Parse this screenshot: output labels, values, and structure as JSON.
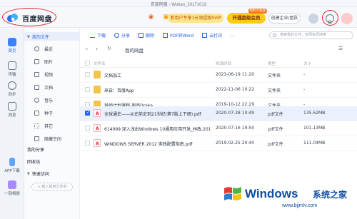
{
  "window_title": "百度网盘 - Wuhan_20171013",
  "header": {
    "app_name": "百度网盘",
    "promo_text": "新用户专享1元领超级SVIP",
    "open_svip": "开通超级会员",
    "open_svip_tag": "福利大放送",
    "enterprise": "创建企业/团队"
  },
  "rail": [
    {
      "label": "首页",
      "icon": "home-icon"
    },
    {
      "label": "传输",
      "icon": "transfer-icon"
    },
    {
      "label": "同步",
      "icon": "sync-icon"
    },
    {
      "label": "消息",
      "icon": "message-icon"
    },
    {
      "label": "APP下载",
      "icon": "phone-icon"
    },
    {
      "label": "一刻相册",
      "icon": "album-icon"
    }
  ],
  "sidebar": {
    "my_files": "我的文件",
    "items": [
      {
        "label": "最近",
        "icon": "clock-icon"
      },
      {
        "label": "图片",
        "icon": "image-icon"
      },
      {
        "label": "视频",
        "icon": "video-icon"
      },
      {
        "label": "文档",
        "icon": "document-icon"
      },
      {
        "label": "音乐",
        "icon": "music-icon"
      },
      {
        "label": "种子",
        "icon": "seed-icon"
      },
      {
        "label": "其它",
        "icon": "more-icon"
      },
      {
        "label": "隐藏空间",
        "icon": "lock-icon"
      }
    ],
    "my_share": "我的分享",
    "recycle": "回收站",
    "quick_access": "快速访问",
    "add_folder": "+ 拖入常用文件夹"
  },
  "toolbar": {
    "upload": "下载",
    "share": "分享",
    "delete": "删除",
    "pdf_to_word": "PDF转Word",
    "print": "云打印",
    "more": "...",
    "search_placeholder": "搜索我的文件，全网资源搜索"
  },
  "breadcrumb": {
    "path": "我的网盘"
  },
  "table": {
    "headers": {
      "name": "文件名",
      "date": "修改时间",
      "type": "类型",
      "size": "大小"
    },
    "rows": [
      {
        "name": "文档加工",
        "date": "2023-06-19 11:20",
        "type": "文件夹",
        "size": "-",
        "kind": "folder",
        "selected": false
      },
      {
        "name": "来自：百度App",
        "date": "2022-11-06 10:22",
        "type": "文件夹",
        "size": "-",
        "kind": "folder",
        "selected": false
      },
      {
        "name": "导师计划课程-周南Drake",
        "date": "2019-10-12 22:29",
        "type": "文件夹",
        "size": "-",
        "kind": "folder",
        "selected": false
      },
      {
        "name": "全球通史——从史前史到21世纪(第7版上下册).pdf",
        "date": "2020-07-28 10:49",
        "type": "pdf文件",
        "size": "135.62MB",
        "kind": "pdf",
        "selected": true
      },
      {
        "name": "614099 深入浅出Windows 10通用应用开发_林政,2016...",
        "date": "2020-07-16 19:50",
        "type": "pdf文件",
        "size": "101.13MB",
        "kind": "pdf",
        "selected": false
      },
      {
        "name": "WINDOWS SERVER 2012 実践配置指南.pdf",
        "date": "2019-02-25 20:40",
        "type": "pdf文件",
        "size": "111.04MB",
        "kind": "pdf",
        "selected": false
      }
    ]
  },
  "watermark": {
    "brand": "Windows",
    "cn": "系统之家",
    "url": "www.bjjmlv.com"
  }
}
